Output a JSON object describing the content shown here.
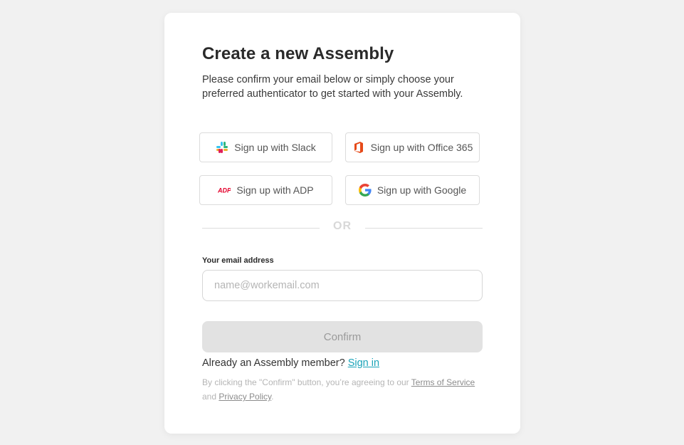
{
  "page": {
    "title": "Create a new Assembly",
    "subtitle": "Please confirm your email below or simply choose your preferred authenticator to get started with your Assembly."
  },
  "sso": {
    "slack": {
      "label": "Sign up with Slack",
      "icon": "slack-icon"
    },
    "office": {
      "label": "Sign up with Office 365",
      "icon": "office365-icon"
    },
    "adp": {
      "label": "Sign up with ADP",
      "icon": "adp-icon"
    },
    "google": {
      "label": "Sign up with Google",
      "icon": "google-icon"
    }
  },
  "divider": {
    "label": "OR"
  },
  "email": {
    "label": "Your email address",
    "placeholder": "name@workemail.com",
    "value": ""
  },
  "confirm": {
    "label": "Confirm"
  },
  "member": {
    "text": "Already an Assembly member? ",
    "link": "Sign in"
  },
  "legal": {
    "prefix": "By clicking the \"Confirm\" button, you’re agreeing to our ",
    "terms": "Terms of Service",
    "middle": " and ",
    "privacy": "Privacy Policy",
    "suffix": "."
  },
  "colors": {
    "background": "#f1f1f1",
    "link": "#1aa3b8",
    "office": "#e64a19",
    "adp": "#e4002b"
  }
}
